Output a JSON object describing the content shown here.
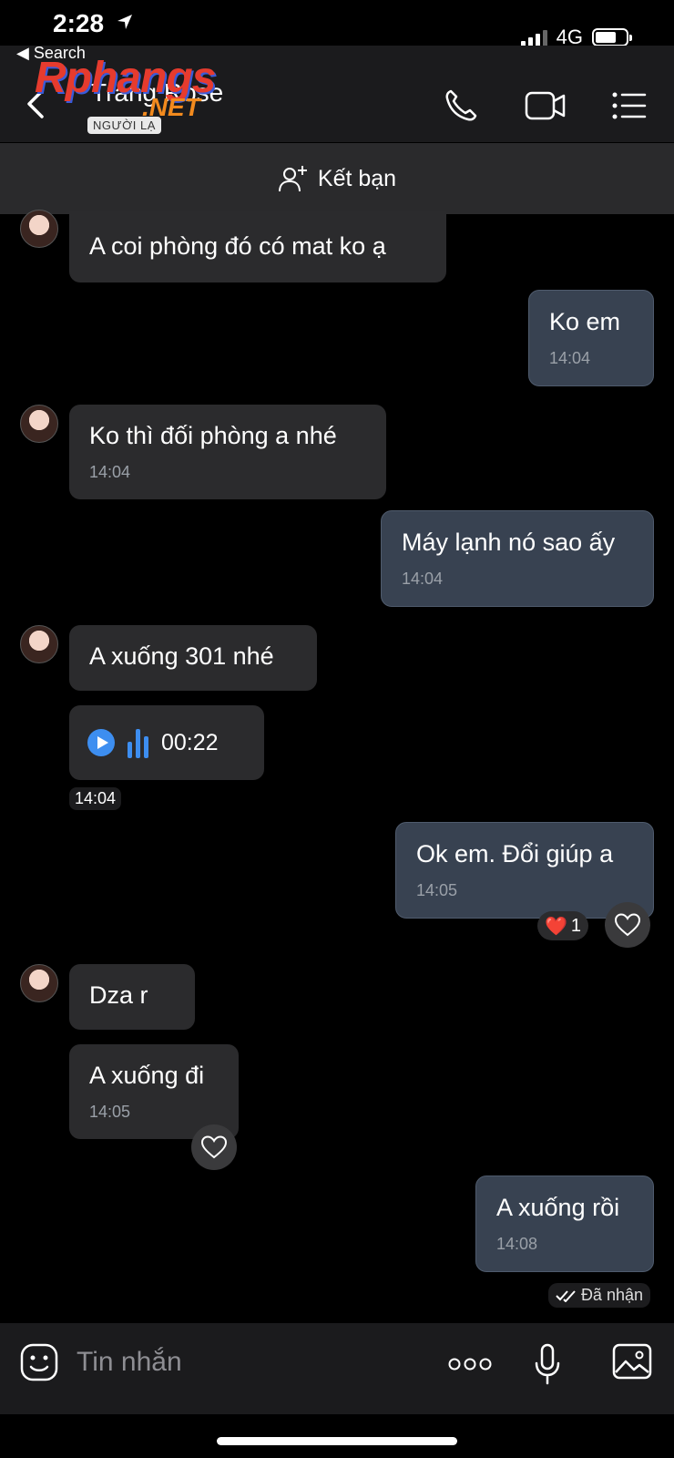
{
  "status": {
    "time": "2:28",
    "network": "4G"
  },
  "header": {
    "back_app": "◀ Search",
    "title": "Trang Rose",
    "badge": "NGƯỜI LẠ",
    "watermark_brand": "Rphangs",
    "watermark_net": ".NET"
  },
  "add_friend": {
    "label": "Kết bạn"
  },
  "messages": [
    {
      "side": "in",
      "text": "A coi phòng đó có mat ko ạ",
      "time": ""
    },
    {
      "side": "out",
      "text": "Ko em",
      "time": "14:04"
    },
    {
      "side": "in",
      "text": "Ko thì đối phòng a nhé",
      "time": "14:04"
    },
    {
      "side": "out",
      "text": "Máy lạnh nó sao ấy",
      "time": "14:04"
    },
    {
      "side": "in",
      "text": "A xuống 301 nhé",
      "time": ""
    },
    {
      "side": "out",
      "text": "Ok em. Đổi giúp a",
      "time": "14:05"
    },
    {
      "side": "in",
      "text": "Dza r",
      "time": ""
    },
    {
      "side": "in",
      "text": "A xuống đi",
      "time": "14:05"
    },
    {
      "side": "out",
      "text": "A xuống rồi",
      "time": "14:08"
    }
  ],
  "voice_message": {
    "duration": "00:22",
    "time": "14:04"
  },
  "reaction": {
    "emoji": "❤️",
    "count": "1"
  },
  "delivery_status": "Đã nhận",
  "input": {
    "placeholder": "Tin nhắn",
    "more_label": "ooo"
  },
  "colors": {
    "accent": "#3d8ef0",
    "outgoing_bubble": "#384251",
    "incoming_bubble": "#2b2b2d"
  }
}
